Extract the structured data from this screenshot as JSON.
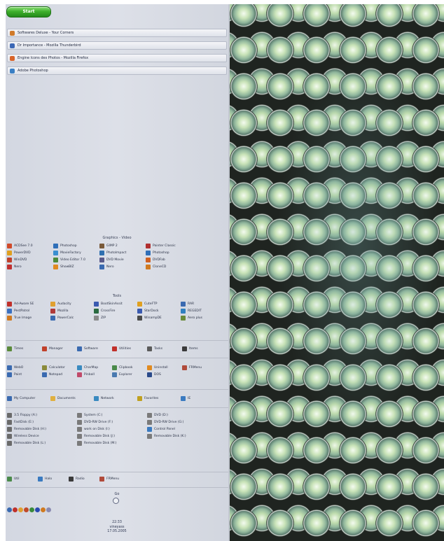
{
  "start_button": {
    "label": "Start"
  },
  "taskbar": [
    {
      "label": "Softwares Deluxe - Your Corners",
      "color": "#d07a2a"
    },
    {
      "label": "Dr Importance - Mozilla Thunderbird",
      "color": "#3b67b5"
    },
    {
      "label": "Engine Icons des Photos - Mozilla Firefox",
      "color": "#d8642a"
    },
    {
      "label": "Adobe Photoshop",
      "color": "#3a7fc4"
    }
  ],
  "graphics_section": {
    "title": "Graphics - Video",
    "rows": [
      [
        {
          "label": "ACDSee 7.0",
          "color": "#d04a2a"
        },
        {
          "label": "Photoshop",
          "color": "#2f6fb8"
        },
        {
          "label": "GIMP 2",
          "color": "#7a5a3a"
        },
        {
          "label": "Painter Classic",
          "color": "#b03030"
        }
      ],
      [
        {
          "label": "PowerDVD",
          "color": "#e0a020"
        },
        {
          "label": "MovieFactory",
          "color": "#3a8fd0"
        },
        {
          "label": "PhotoImpact",
          "color": "#3070b0"
        },
        {
          "label": "Photoshop",
          "color": "#2f6fb8"
        }
      ],
      [
        {
          "label": "WinDVD",
          "color": "#c0402a"
        },
        {
          "label": "Video Editor 7.0",
          "color": "#4a8a3a"
        },
        {
          "label": "DVD Movie",
          "color": "#5a5a8a"
        },
        {
          "label": "DVDFab",
          "color": "#d06020"
        }
      ],
      [
        {
          "label": "Nero",
          "color": "#c03030"
        },
        {
          "label": "ShowBIZ",
          "color": "#e08a20"
        },
        {
          "label": "Nero",
          "color": "#3a6ab0"
        },
        {
          "label": "CloneCD",
          "color": "#d07a20"
        }
      ]
    ]
  },
  "tools_section": {
    "title": "Tools",
    "rows": [
      [
        {
          "label": "Ad-Aware SE",
          "color": "#c0302a"
        },
        {
          "label": "Audacity",
          "color": "#e0a030"
        },
        {
          "label": "BootSkinAssit",
          "color": "#3a5ab0"
        },
        {
          "label": "CuteFTP",
          "color": "#e0a020"
        },
        {
          "label": "RAR",
          "color": "#3a6ab0"
        }
      ],
      [
        {
          "label": "PestPatrol",
          "color": "#3a70c0"
        },
        {
          "label": "Mozilla",
          "color": "#b03a3a"
        },
        {
          "label": "CrossFire",
          "color": "#2a6a40"
        },
        {
          "label": "StarDock",
          "color": "#3a5ab0"
        },
        {
          "label": "REGEDIT",
          "color": "#3080c0"
        }
      ],
      [
        {
          "label": "True Image",
          "color": "#d07a20"
        },
        {
          "label": "PowerCalc",
          "color": "#3a6ab0"
        },
        {
          "label": "ZIP",
          "color": "#8a8a8a"
        },
        {
          "label": "WinampDE",
          "color": "#4a4a4a"
        },
        {
          "label": "Aero plus",
          "color": "#6a8a3a"
        }
      ]
    ]
  },
  "quick_strip": [
    {
      "label": "Times",
      "color": "#5a8a3a"
    },
    {
      "label": "Manager",
      "color": "#c0402a"
    },
    {
      "label": "Software",
      "color": "#3a6ab0"
    },
    {
      "label": "Utilities",
      "color": "#c0302a"
    },
    {
      "label": "Tasks",
      "color": "#5a5a5a"
    },
    {
      "label": "Items",
      "color": "#3a3a3a"
    }
  ],
  "apps_section": {
    "rows": [
      [
        {
          "label": "WebO",
          "color": "#3a6ab0"
        },
        {
          "label": "Calculator",
          "color": "#8a8a3a"
        },
        {
          "label": "CharMap",
          "color": "#3a8ac0"
        },
        {
          "label": "Clipbook",
          "color": "#4a8a4a"
        },
        {
          "label": "Uninstall",
          "color": "#e08a20"
        },
        {
          "label": "FRMenu",
          "color": "#b04a3a"
        }
      ],
      [
        {
          "label": "Paint",
          "color": "#3a6ab0"
        },
        {
          "label": "Notepad",
          "color": "#3a6ab0"
        },
        {
          "label": "Pinball",
          "color": "#c04a6a"
        },
        {
          "label": "Explorer",
          "color": "#4a7ab0"
        },
        {
          "label": "DOS",
          "color": "#2a4a8a"
        }
      ]
    ]
  },
  "places_strip": [
    {
      "label": "My Computer",
      "color": "#3a6ab0"
    },
    {
      "label": "Documents",
      "color": "#e0b040"
    },
    {
      "label": "Network",
      "color": "#3a8ac0"
    },
    {
      "label": "Favorites",
      "color": "#c0a020"
    },
    {
      "label": "IE",
      "color": "#3a7ac0"
    }
  ],
  "drives_section": {
    "rows": [
      [
        {
          "label": "3.5 Floppy (A:)",
          "color": "#6a6a6a"
        },
        {
          "label": "System (C:)",
          "color": "#7a7a7a"
        },
        {
          "label": "DVD (D:)",
          "color": "#7a7a7a"
        }
      ],
      [
        {
          "label": "FastDisk (E:)",
          "color": "#6a6a6a"
        },
        {
          "label": "DVD-RW Drive (F:)",
          "color": "#7a7a7a"
        },
        {
          "label": "DVD-RW Drive (G:)",
          "color": "#7a7a7a"
        }
      ],
      [
        {
          "label": "Removable Disk (H:)",
          "color": "#6a6a6a"
        },
        {
          "label": "work on Disk (I:)",
          "color": "#7a7a7a"
        },
        {
          "label": "Control Panel",
          "color": "#3a7ac0"
        }
      ],
      [
        {
          "label": "Wireless Device",
          "color": "#6a6a6a"
        },
        {
          "label": "Removable Disk (J:)",
          "color": "#7a7a7a"
        },
        {
          "label": "Removable Disk (K:)",
          "color": "#7a7a7a"
        }
      ],
      [
        {
          "label": "Removable Disk (L:)",
          "color": "#6a6a6a"
        },
        {
          "label": "Removable Disk (M:)",
          "color": "#7a7a7a"
        }
      ]
    ]
  },
  "bottom_strip": [
    {
      "label": "Util",
      "color": "#4a8a4a"
    },
    {
      "label": "Halo",
      "color": "#3a7ac0"
    },
    {
      "label": "Radio",
      "color": "#3a3a3a"
    },
    {
      "label": "FRMenu",
      "color": "#b04a3a"
    }
  ],
  "search": {
    "label": "Go"
  },
  "tray_icons": [
    {
      "name": "tray-1",
      "color": "#3a6ab0"
    },
    {
      "name": "tray-2",
      "color": "#c0302a"
    },
    {
      "name": "tray-3",
      "color": "#e0a030"
    },
    {
      "name": "tray-4",
      "color": "#c04a2a"
    },
    {
      "name": "tray-5",
      "color": "#3a8a3a"
    },
    {
      "name": "tray-6",
      "color": "#2a4ab0"
    },
    {
      "name": "tray-7",
      "color": "#d07a20"
    },
    {
      "name": "tray-8",
      "color": "#8a8ab0"
    }
  ],
  "clock": {
    "time": "22:33",
    "day": "vineyass",
    "date": "17.05.2005"
  }
}
